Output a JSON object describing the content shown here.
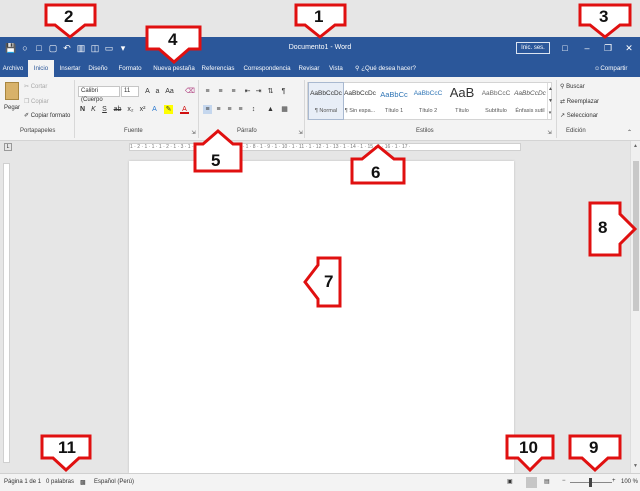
{
  "window": {
    "title": "Documento1 - Word",
    "sign_in": "Inic. ses.",
    "qat_icons": [
      "save-icon",
      "touch-mode-icon",
      "spelling-icon",
      "document-icon",
      "undo-icon",
      "print-preview-icon",
      "new-icon",
      "open-icon",
      "more-icon"
    ]
  },
  "tabs": [
    "Archivo",
    "Inicio",
    "Insertar",
    "Diseño",
    "Formato",
    "Nueva pestaña",
    "Referencias",
    "Correspondencia",
    "Revisar",
    "Vista"
  ],
  "active_tab": "Inicio",
  "tell_me": "¿Qué desea hacer?",
  "share": "Compartir",
  "ribbon": {
    "clipboard": {
      "paste": "Pegar",
      "cut": "Cortar",
      "copy": "Copiar",
      "format_painter": "Copiar formato",
      "label": "Portapapeles"
    },
    "font": {
      "font_name": "Calibri (Cuerpo",
      "font_size": "11",
      "label": "Fuente"
    },
    "paragraph": {
      "label": "Párrafo"
    },
    "styles": {
      "label": "Estilos",
      "items": [
        {
          "preview": "AaBbCcDc",
          "name": "¶ Normal"
        },
        {
          "preview": "AaBbCcDc",
          "name": "¶ Sin espa..."
        },
        {
          "preview": "AaBbCc",
          "name": "Título 1"
        },
        {
          "preview": "AaBbCcC",
          "name": "Título 2"
        },
        {
          "preview": "AaB",
          "name": "Título"
        },
        {
          "preview": "AaBbCcC",
          "name": "Subtítulo"
        },
        {
          "preview": "AaBbCcDc",
          "name": "Énfasis sutil"
        }
      ]
    },
    "editing": {
      "find": "Buscar",
      "replace": "Reemplazar",
      "select": "Seleccionar",
      "label": "Edición"
    }
  },
  "ruler": {
    "text": "1 · 2 · 1 · 1 · 1 · 2 · 1 · 3 · 1 · 4 · 1 · 5 · 1 · 6 · 1 · 7 · 1 · 8 · 1 · 9 · 1 · 10 · 1 · 11 · 1 · 12 · 1 · 13 · 1 · 14 · 1 · 15 · 1 · 16 · 1 · 17 ·"
  },
  "status": {
    "page": "Página 1 de 1",
    "words": "0 palabras",
    "language": "Español (Perú)",
    "zoom": "100 %"
  },
  "callouts": [
    "1",
    "2",
    "3",
    "4",
    "5",
    "6",
    "7",
    "8",
    "9",
    "10",
    "11"
  ],
  "colors": {
    "brand": "#2b579a",
    "callout_border": "#e01010"
  }
}
